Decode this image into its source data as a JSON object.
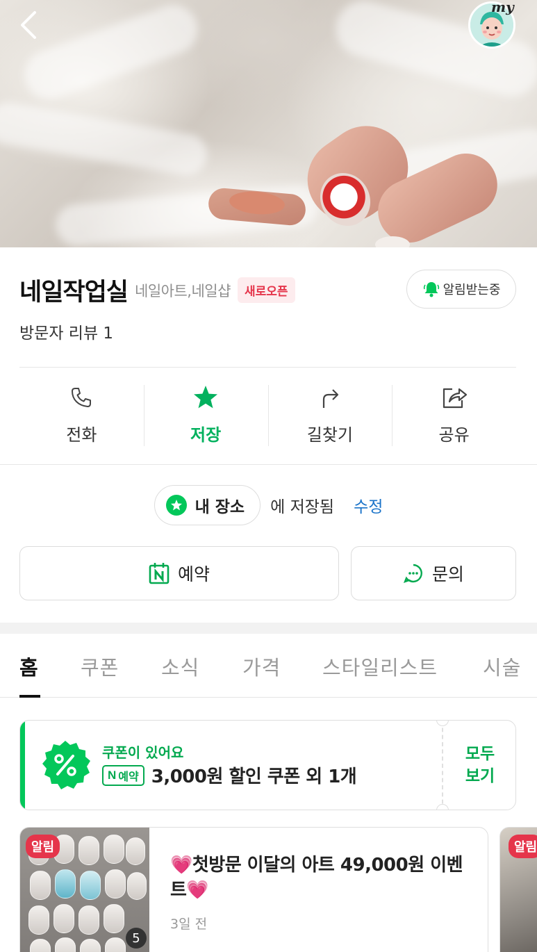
{
  "hero": {
    "my_label": "my"
  },
  "place": {
    "name": "네일작업실",
    "category": "네일아트,네일샵",
    "new_badge": "새로오픈",
    "alert_button": "알림받는중",
    "review": "방문자 리뷰 1"
  },
  "actions": [
    {
      "label": "전화",
      "icon": "phone-icon"
    },
    {
      "label": "저장",
      "icon": "star-icon",
      "active_color": "#03b15e"
    },
    {
      "label": "길찾기",
      "icon": "directions-icon"
    },
    {
      "label": "공유",
      "icon": "share-icon"
    }
  ],
  "saved": {
    "pill_label": "내 장소",
    "saved_text": "에 저장됨",
    "edit_label": "수정"
  },
  "buttons": {
    "reserve": "예약",
    "inquire": "문의"
  },
  "tabs": [
    {
      "label": "홈",
      "active": true
    },
    {
      "label": "쿠폰"
    },
    {
      "label": "소식"
    },
    {
      "label": "가격"
    },
    {
      "label": "스타일리스트"
    },
    {
      "label": "시술"
    }
  ],
  "coupon": {
    "title": "쿠폰이 있어요",
    "npay_n": "N",
    "npay_label": "예약",
    "description": "3,000원 할인 쿠폰 외 1개",
    "more_line1": "모두",
    "more_line2": "보기"
  },
  "news": {
    "badge": "알림",
    "image_count": "5",
    "text": "💗첫방문 이달의 아트 49,000원 이벤트💗",
    "time": "3일 전"
  },
  "news2": {
    "badge": "알림"
  },
  "colors": {
    "brand_green": "#03c75a",
    "alert_red": "#e5354b",
    "link_blue": "#1a73c9"
  }
}
